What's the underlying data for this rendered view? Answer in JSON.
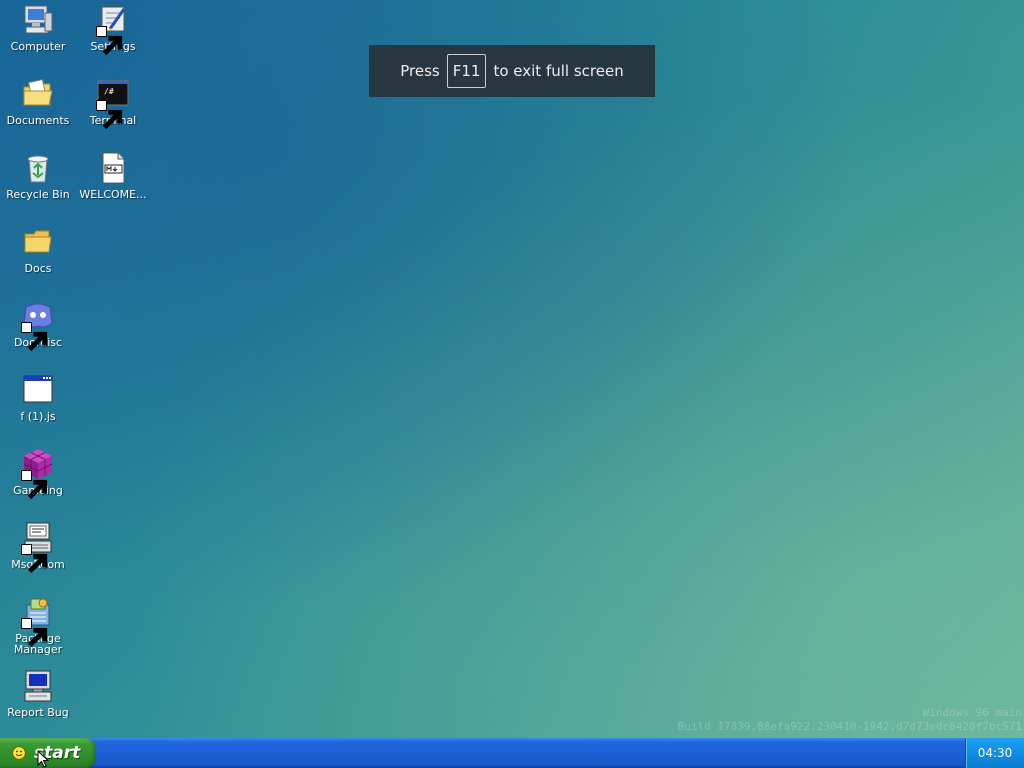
{
  "desktop": {
    "icons": [
      {
        "label": "Computer",
        "icon": "computer-icon",
        "shortcut": false
      },
      {
        "label": "Settings",
        "icon": "settings-icon",
        "shortcut": true
      },
      {
        "label": "Documents",
        "icon": "documents-folder-icon",
        "shortcut": false
      },
      {
        "label": "Terminal",
        "icon": "terminal-icon",
        "shortcut": true
      },
      {
        "label": "Recycle Bin",
        "icon": "recycle-bin-icon",
        "shortcut": false
      },
      {
        "label": "WELCOME...",
        "icon": "markdown-file-icon",
        "shortcut": false
      },
      {
        "label": "Docs",
        "icon": "folder-icon",
        "shortcut": false
      },
      {
        "label": "Doordisc",
        "icon": "doordisc-icon",
        "shortcut": true
      },
      {
        "label": "f (1).js",
        "icon": "window-file-icon",
        "shortcut": false
      },
      {
        "label": "Gameing",
        "icon": "cube-icon",
        "shortcut": true
      },
      {
        "label": "MsgRoom",
        "icon": "msgroom-icon",
        "shortcut": true
      },
      {
        "label": "Package Manager",
        "icon": "package-manager-icon",
        "shortcut": true
      },
      {
        "label": "Report Bug",
        "icon": "report-bug-icon",
        "shortcut": false
      }
    ]
  },
  "fullscreen_toast": {
    "prefix": "Press",
    "key": "F11",
    "suffix": "to exit full screen"
  },
  "watermark": {
    "line1": "Windows 96 main",
    "line2": "Build 17839.88efa922.230410-1942.d7d73edc8428f7bc571"
  },
  "taskbar": {
    "start_label": "start",
    "clock": "04:30"
  },
  "colors": {
    "taskbar_blue": "#1b5fd6",
    "start_green": "#3a9a33",
    "tray_blue": "#0f8ee4",
    "toast_bg": "#28323a"
  }
}
